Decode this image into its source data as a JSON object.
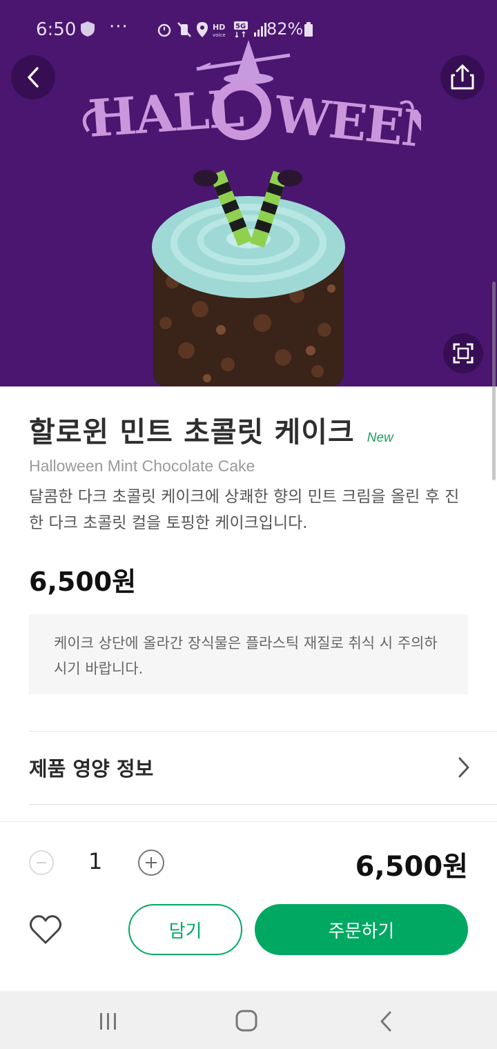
{
  "status": {
    "time": "6:50",
    "dots": "···",
    "battery": "82%"
  },
  "product": {
    "name": "할로윈 민트 초콜릿 케이크",
    "badge": "New",
    "english_name": "Halloween Mint Chocolate Cake",
    "description": "달콤한 다크 초콜릿 케이크에 상쾌한 향의 민트 크림을 올린 후 진한 다크 초콜릿 컬을 토핑한 케이크입니다.",
    "price": "6,500원",
    "notice": "케이크 상단에 올라간 장식물은 플라스틱 재질로 취식 시 주의하시기 바랍니다.",
    "hero_logo_text": "HALLOWEEN"
  },
  "nutrition": {
    "label": "제품 영양 정보"
  },
  "order": {
    "quantity": "1",
    "total": "6,500원",
    "cart_label": "담기",
    "order_label": "주문하기"
  },
  "colors": {
    "hero_bg": "#4a1670",
    "accent_green": "#00a862",
    "new_badge": "#1aa35a"
  },
  "icons": [
    "shield-icon",
    "back-arrow-icon",
    "share-icon",
    "expand-icon",
    "heart-icon",
    "chevron-right-icon",
    "minus-icon",
    "plus-icon",
    "recent-apps-icon",
    "home-icon",
    "nav-back-icon"
  ]
}
